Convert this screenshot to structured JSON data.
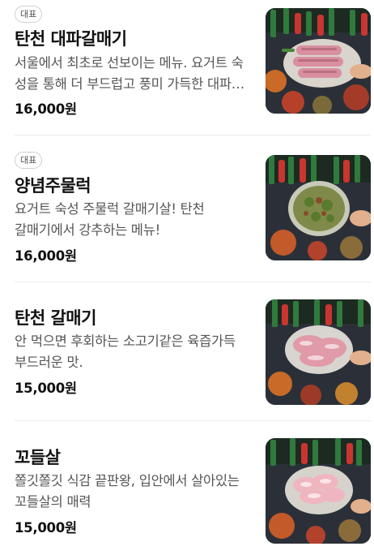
{
  "menu": {
    "items": [
      {
        "badge": "대표",
        "name": "탄천 대파갈매기",
        "description": "서울에서 최초로 선보이는 메뉴. 요거트 숙성을 통해 더 부드럽고 풍미 가득한 대파갈매기",
        "price": "16,000원",
        "image": "plate-of-raw-pork-with-scallions"
      },
      {
        "badge": "대표",
        "name": "양념주물럭",
        "description": "요거트 숙성 주물럭 갈매기살! 탄천 갈매기에서 강추하는 메뉴!",
        "price": "16,000원",
        "image": "bowl-of-seasoned-pork-with-greens"
      },
      {
        "name": "탄천 갈매기",
        "description": "안 먹으면 후회하는 소고기같은 육즙가득 부드러운 맛.",
        "price": "15,000원",
        "image": "plate-of-raw-pork-slices"
      },
      {
        "name": "꼬들살",
        "description": "쫄깃쫄깃 식감 끝판왕, 입안에서 살아있는 꼬들살의 매력",
        "price": "15,000원",
        "image": "plate-of-pink-pork-neck"
      }
    ]
  }
}
